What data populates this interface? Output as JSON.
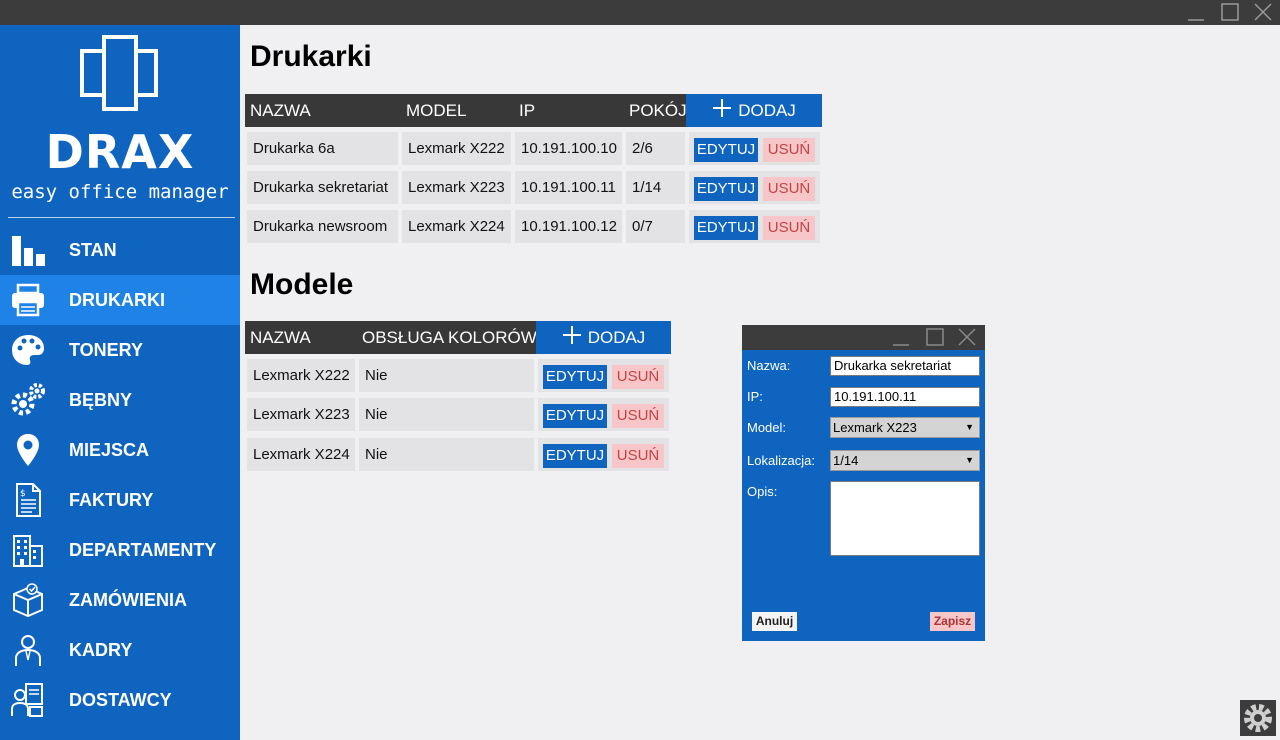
{
  "window": {
    "minimize_icon": "minimize-icon",
    "maximize_icon": "maximize-icon",
    "close_icon": "close-icon"
  },
  "sidebar": {
    "brand": "DRAX",
    "tagline": "easy office manager",
    "active": "DRUKARKI",
    "items": [
      {
        "label": "STAN",
        "icon": "bar-chart-icon"
      },
      {
        "label": "DRUKARKI",
        "icon": "printer-icon"
      },
      {
        "label": "TONERY",
        "icon": "palette-icon"
      },
      {
        "label": "BĘBNY",
        "icon": "gears-icon"
      },
      {
        "label": "MIEJSCA",
        "icon": "map-pin-icon"
      },
      {
        "label": "FAKTURY",
        "icon": "invoice-icon"
      },
      {
        "label": "DEPARTAMENTY",
        "icon": "building-icon"
      },
      {
        "label": "ZAMÓWIENIA",
        "icon": "package-icon"
      },
      {
        "label": "KADRY",
        "icon": "person-icon"
      },
      {
        "label": "DOSTAWCY",
        "icon": "supplier-icon"
      }
    ]
  },
  "printers": {
    "title": "Drukarki",
    "columns": [
      "NAZWA",
      "MODEL",
      "IP",
      "POKÓJ"
    ],
    "add_label": "DODAJ",
    "edit_label": "EDYTUJ",
    "delete_label": "USUŃ",
    "rows": [
      {
        "name": "Drukarka 6a",
        "model": "Lexmark X222",
        "ip": "10.191.100.10",
        "room": "2/6"
      },
      {
        "name": "Drukarka sekretariat",
        "model": "Lexmark X223",
        "ip": "10.191.100.11",
        "room": "1/14"
      },
      {
        "name": "Drukarka newsroom",
        "model": "Lexmark X224",
        "ip": "10.191.100.12",
        "room": "0/7"
      }
    ]
  },
  "models": {
    "title": "Modele",
    "columns": [
      "NAZWA",
      "OBSŁUGA KOLORÓW"
    ],
    "add_label": "DODAJ",
    "edit_label": "EDYTUJ",
    "delete_label": "USUŃ",
    "rows": [
      {
        "name": "Lexmark X222",
        "color": "Nie"
      },
      {
        "name": "Lexmark X223",
        "color": "Nie"
      },
      {
        "name": "Lexmark X224",
        "color": "Nie"
      }
    ]
  },
  "dialog": {
    "name_label": "Nazwa:",
    "name_value": "Drukarka sekretariat",
    "ip_label": "IP:",
    "ip_value": "10.191.100.11",
    "model_label": "Model:",
    "model_value": "Lexmark X223",
    "location_label": "Lokalizacja:",
    "location_value": "1/14",
    "desc_label": "Opis:",
    "desc_value": "",
    "cancel_label": "Anuluj",
    "save_label": "Zapisz"
  },
  "colors": {
    "primary": "#0f64c0",
    "active_nav": "#1e82e6",
    "header": "#383838",
    "delete_bg": "#f6c6c8",
    "delete_text": "#c24545"
  }
}
